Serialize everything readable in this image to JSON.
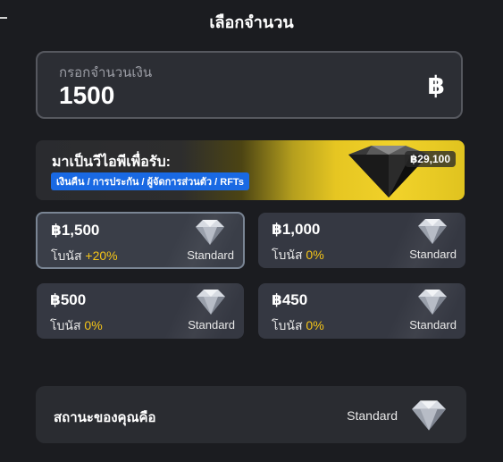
{
  "header": {
    "title": "เลือกจำนวน"
  },
  "amount_input": {
    "placeholder": "กรอกจำนวนเงิน",
    "value": "1500",
    "currency_symbol": "฿"
  },
  "vip_banner": {
    "title": "มาเป็นวีไอพีเพื่อรับ:",
    "benefits": "เงินคืน / การประกัน / ผู้จัดการส่วนตัว / RFTs",
    "price": "฿29,100"
  },
  "options": [
    {
      "amount": "฿1,500",
      "bonus_label": "โบนัส",
      "bonus_value": "+20%",
      "tier": "Standard",
      "selected": true
    },
    {
      "amount": "฿1,000",
      "bonus_label": "โบนัส",
      "bonus_value": "0%",
      "tier": "Standard",
      "selected": false
    },
    {
      "amount": "฿500",
      "bonus_label": "โบนัส",
      "bonus_value": "0%",
      "tier": "Standard",
      "selected": false
    },
    {
      "amount": "฿450",
      "bonus_label": "โบนัส",
      "bonus_value": "0%",
      "tier": "Standard",
      "selected": false
    }
  ],
  "status": {
    "label": "สถานะของคุณคือ",
    "tier": "Standard"
  },
  "colors": {
    "background": "#1b1c20",
    "card": "#353842",
    "accent_bonus": "#f5c518",
    "tag_blue": "#1969e3",
    "gold": "#e6c622"
  },
  "icons": {
    "gem": "diamond-icon"
  }
}
